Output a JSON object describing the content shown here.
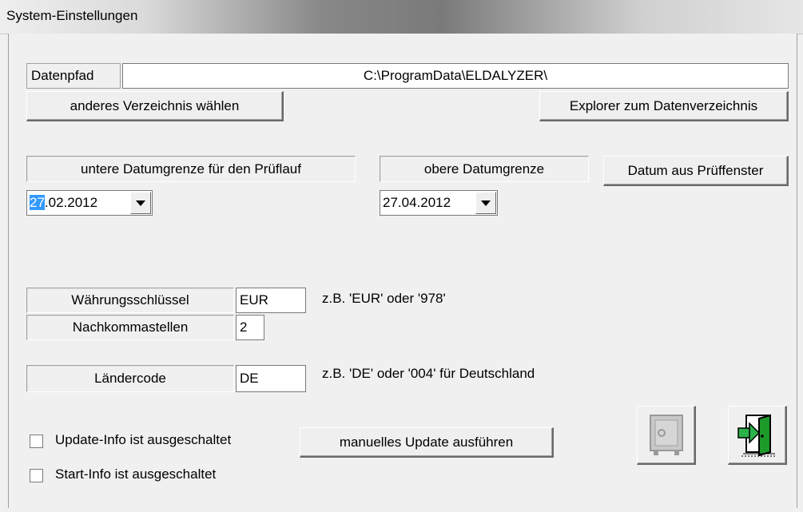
{
  "window": {
    "title": "System-Einstellungen"
  },
  "datapath": {
    "label": "Datenpfad",
    "value": "C:\\ProgramData\\ELDALYZER\\",
    "choose_button": "anderes Verzeichnis wählen",
    "explorer_button": "Explorer zum Datenverzeichnis"
  },
  "dates": {
    "lower_label": "untere Datumgrenze für den Prüflauf",
    "lower_value_selected": "27",
    "lower_value_rest": ".02.2012",
    "upper_label": "obere Datumgrenze",
    "upper_value": "27.04.2012",
    "from_window_button": "Datum aus Prüffenster"
  },
  "currency": {
    "key_label": "Währungsschlüssel",
    "key_value": "EUR",
    "key_hint": "z.B. 'EUR' oder '978'",
    "decimals_label": "Nachkommastellen",
    "decimals_value": "2"
  },
  "country": {
    "label": "Ländercode",
    "value": "DE",
    "hint": "z.B. 'DE' oder '004' für Deutschland"
  },
  "options": {
    "update_info_label": "Update-Info ist ausgeschaltet",
    "update_info_checked": false,
    "start_info_label": "Start-Info ist ausgeschaltet",
    "start_info_checked": false,
    "manual_update_button": "manuelles Update ausführen"
  },
  "icons": {
    "safe": "safe-icon",
    "exit": "exit-door-icon"
  }
}
